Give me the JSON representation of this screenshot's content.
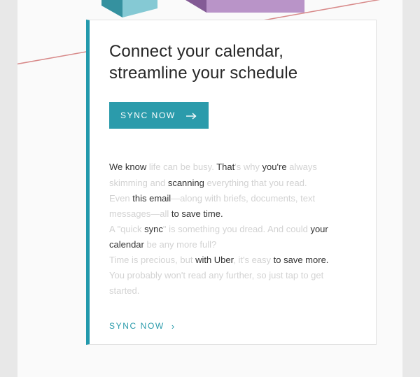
{
  "heading_line1": "Connect your calendar,",
  "heading_line2": "streamline your schedule",
  "cta_label": "SYNC NOW",
  "link_label": "SYNC NOW",
  "body": {
    "p1": {
      "s1": "We know ",
      "f1": "life can be busy. ",
      "s2": "That",
      "f2": "'s why ",
      "s3": "you're ",
      "f3": "always skimming and ",
      "s4": "scanning ",
      "f4": "everything that you read."
    },
    "p2": {
      "f1": "Even ",
      "s1": "this email",
      "f2": "—along with briefs, documents, text messages—all ",
      "s2": "to save time."
    },
    "p3": {
      "f1": "A \"quick ",
      "s1": "sync",
      "f2": "\" is something you dread. And could ",
      "s2": "your calendar ",
      "f3": "be any more full?"
    },
    "p4": {
      "f1": "Time is precious, but ",
      "s1": "with Uber",
      "f2": ", it's easy ",
      "s2": "to save more."
    },
    "p5": {
      "f1": "You probably won't read any further, so just tap to get started."
    }
  }
}
